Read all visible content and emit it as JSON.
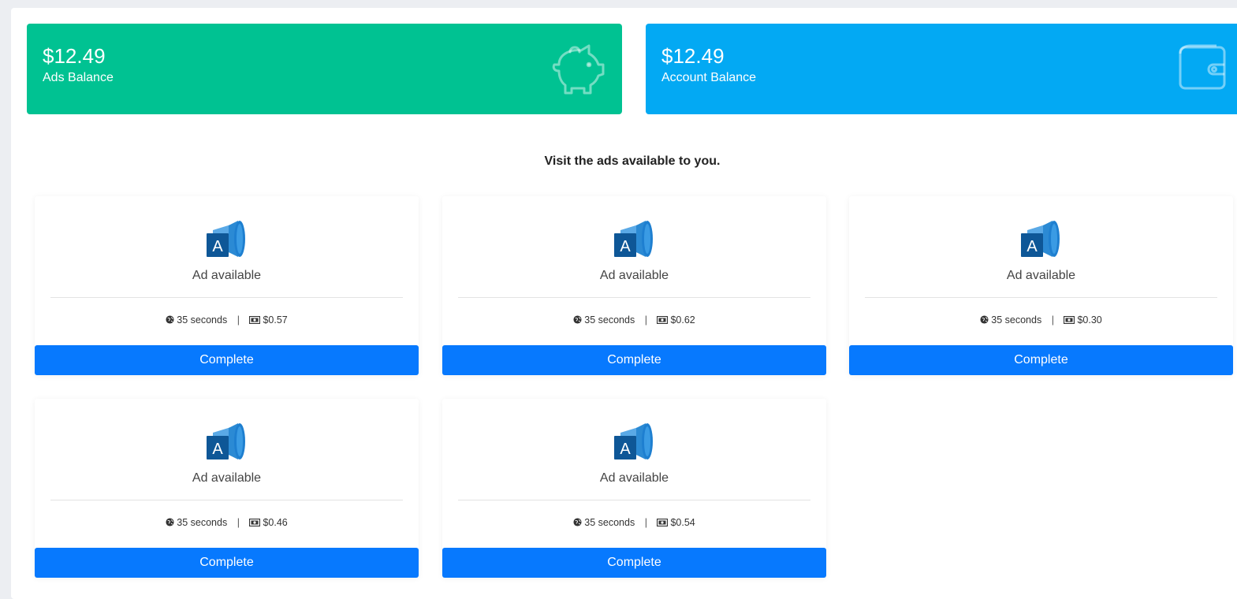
{
  "balances": {
    "ads": {
      "amount": "$12.49",
      "label": "Ads Balance",
      "icon": "piggy-bank-icon"
    },
    "account": {
      "amount": "$12.49",
      "label": "Account Balance",
      "icon": "wallet-icon"
    }
  },
  "heading": "Visit the ads available to you.",
  "colors": {
    "green": "#00c292",
    "blue": "#03a9f3",
    "button": "#0779fe"
  },
  "ads": [
    {
      "title": "Ad available",
      "duration": "35 seconds",
      "reward": "$0.57",
      "button": "Complete"
    },
    {
      "title": "Ad available",
      "duration": "35 seconds",
      "reward": "$0.62",
      "button": "Complete"
    },
    {
      "title": "Ad available",
      "duration": "35 seconds",
      "reward": "$0.30",
      "button": "Complete"
    },
    {
      "title": "Ad available",
      "duration": "35 seconds",
      "reward": "$0.46",
      "button": "Complete"
    },
    {
      "title": "Ad available",
      "duration": "35 seconds",
      "reward": "$0.54",
      "button": "Complete"
    }
  ]
}
